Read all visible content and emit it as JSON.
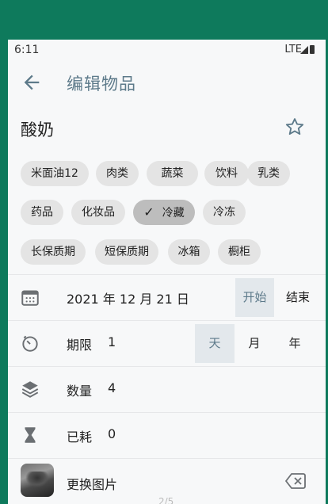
{
  "status_bar": {
    "time": "6:11",
    "network": "LTE"
  },
  "app_bar": {
    "title": "编辑物品"
  },
  "item": {
    "name": "酸奶"
  },
  "chips": [
    {
      "label": "米面油12",
      "selected": false
    },
    {
      "label": "肉类",
      "selected": false
    },
    {
      "label": "蔬菜",
      "selected": false
    },
    {
      "label": "饮料",
      "selected": false
    },
    {
      "label": "乳类",
      "selected": false
    },
    {
      "label": "药品",
      "selected": false
    },
    {
      "label": "化妆品",
      "selected": false
    },
    {
      "label": "冷藏",
      "selected": true
    },
    {
      "label": "冷冻",
      "selected": false
    },
    {
      "label": "长保质期",
      "selected": false
    },
    {
      "label": "短保质期",
      "selected": false
    },
    {
      "label": "冰箱",
      "selected": false
    },
    {
      "label": "橱柜",
      "selected": false
    }
  ],
  "date_row": {
    "value": "2021 年 12 月 21 日",
    "start_label": "开始",
    "end_label": "结束",
    "active": "开始"
  },
  "period_row": {
    "label": "期限",
    "value": "1",
    "units": [
      "天",
      "月",
      "年"
    ],
    "active_unit": "天"
  },
  "quantity_row": {
    "label": "数量",
    "value": "4"
  },
  "consumed_row": {
    "label": "已耗",
    "value": "0"
  },
  "image_row": {
    "label": "更换图片"
  },
  "pager": "2/5",
  "colors": {
    "frame": "#0e7a5c",
    "accent": "#5d7a8a",
    "chip_bg": "#e4e4e4",
    "chip_selected_bg": "#bdbdbd"
  }
}
